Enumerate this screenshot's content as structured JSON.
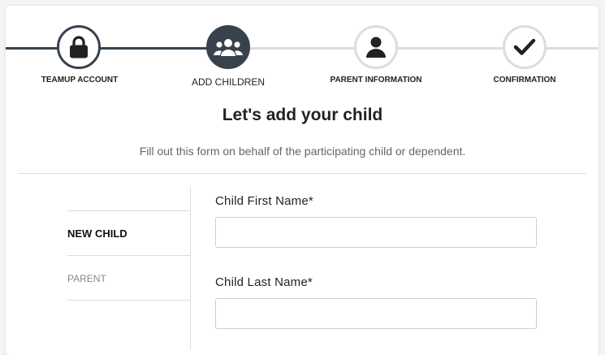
{
  "stepper": {
    "steps": [
      {
        "label": "TEAMUP ACCOUNT",
        "icon": "lock-icon",
        "state": "done"
      },
      {
        "label": "ADD CHILDREN",
        "icon": "group-icon",
        "state": "active"
      },
      {
        "label": "PARENT INFORMATION",
        "icon": "user-icon",
        "state": "todo"
      },
      {
        "label": "CONFIRMATION",
        "icon": "checkmark-icon",
        "state": "todo"
      }
    ]
  },
  "heading": {
    "title": "Let's add your child",
    "subtitle": "Fill out this form on behalf of the participating child or dependent."
  },
  "nav": {
    "items": [
      {
        "label": "NEW CHILD",
        "active": true
      },
      {
        "label": "PARENT",
        "active": false
      }
    ]
  },
  "form": {
    "first_name": {
      "label": "Child First Name*",
      "value": ""
    },
    "last_name": {
      "label": "Child Last Name*",
      "value": ""
    }
  },
  "colors": {
    "accent": "#37424d",
    "inactive": "#dcdcdc"
  }
}
